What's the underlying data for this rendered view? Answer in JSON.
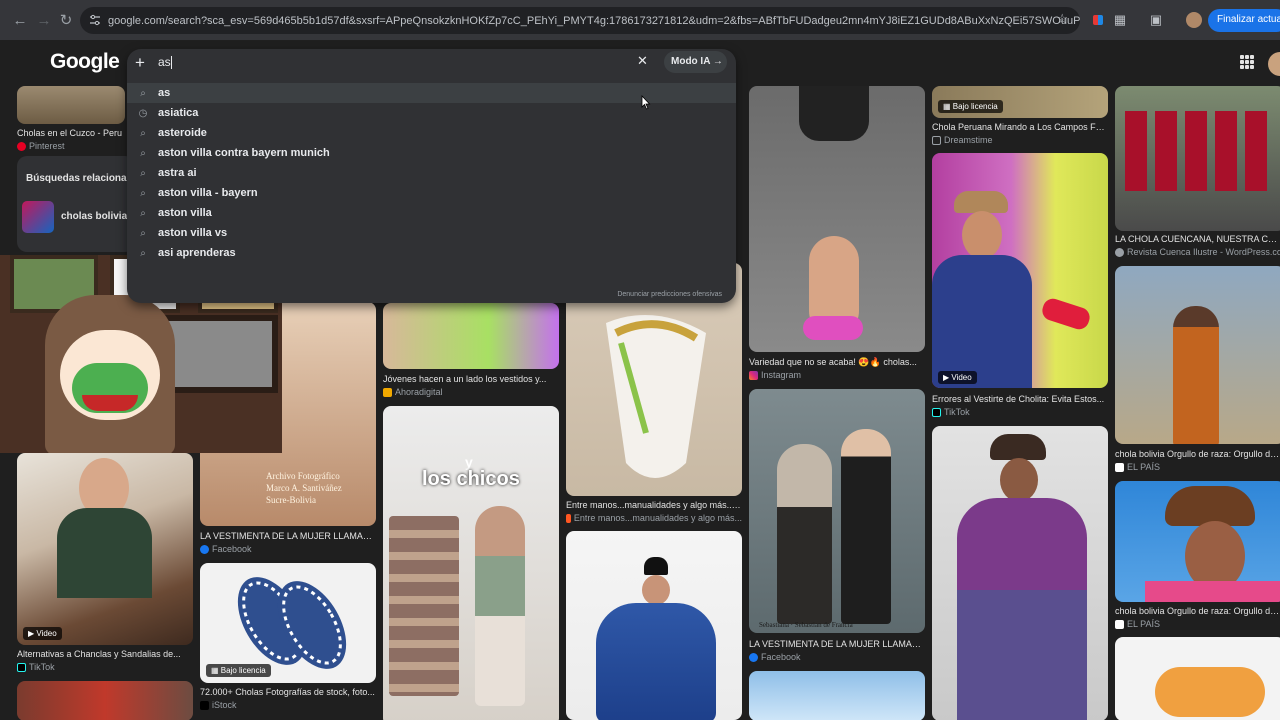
{
  "browser": {
    "url": "google.com/search?sca_esv=569d465b5b1d57df&sxsrf=APpeQnsokzknHOKfZp7cC_PEhYi_PMYT4g:1786173271812&udm=2&fbs=ABfTbFUDadgeu2mn4mYJ8iEZ1GUDd8ABuXxNzQEi57SWOuuPdfVFhgBbO079P_7XyIRU...",
    "update_label": "Finalizar actualiz"
  },
  "header": {
    "logo": "Google"
  },
  "search": {
    "query": "as",
    "ai_mode_label": "Modo IA",
    "suggestions": [
      {
        "text": "as",
        "icon": "search-icon"
      },
      {
        "text": "asiatica",
        "icon": "history-icon"
      },
      {
        "text": "asteroide",
        "icon": "search-icon"
      },
      {
        "text": "aston villa contra bayern munich",
        "icon": "search-icon"
      },
      {
        "text": "astra ai",
        "icon": "search-icon"
      },
      {
        "text": "aston villa - bayern",
        "icon": "search-icon"
      },
      {
        "text": "aston villa",
        "icon": "search-icon"
      },
      {
        "text": "aston villa vs",
        "icon": "search-icon"
      },
      {
        "text": "asi aprenderas",
        "icon": "search-icon"
      }
    ],
    "report_label": "Denunciar predicciones ofensivas"
  },
  "related": {
    "title": "Búsquedas relacionad",
    "item": "cholas bolivian"
  },
  "results": {
    "col1_top": {
      "caption": "Cholas en el Cuzco - Peru",
      "source": "Pinterest"
    },
    "col1_video": {
      "caption": "Alternativas a Chanclas y Sandalias de...",
      "source": "TikTok",
      "badge": "Video"
    },
    "col2_mid": {
      "caption": "LA VESTIMENTA DE LA MUJER LLAMADA...",
      "source": "Facebook",
      "watermark1": "Archivo Fotográfico",
      "watermark2": "Marco A. Santiváñez",
      "watermark3": "Sucre-Bolivia"
    },
    "col2_bottom": {
      "caption": "72.000+ Cholas Fotografías de stock, foto...",
      "source": "iStock",
      "badge": "Bajo licencia"
    },
    "col3_top": {
      "caption": "Jóvenes hacen a un lado los vestidos y...",
      "source": "Ahoradigital"
    },
    "col3_chicos": {
      "overlay_small": "y",
      "overlay": "los chicos"
    },
    "col4_mid": {
      "caption": "Entre manos...manualidades y algo más...:...",
      "source": "Entre manos...manualidades y algo más..."
    },
    "col5_top": {
      "caption": "Variedad que no se acaba! 😍🔥 cholas...",
      "source": "Instagram"
    },
    "col5_mid": {
      "caption": "LA VESTIMENTA DE LA MUJER LLAMADA...",
      "source": "Facebook",
      "photo_caption": "Sebastiana · Sebastian de Francia"
    },
    "col6_top": {
      "caption": "Chola Peruana Mirando a Los Campos Fot...",
      "source": "Dreamstime",
      "badge": "Bajo licencia"
    },
    "col6_mid": {
      "caption": "Errores al Vestirte de Cholita: Evita Estos...",
      "source": "TikTok",
      "badge": "Video"
    },
    "col7_top": {
      "caption": "LA CHOLA CUENCANA, NUESTRA CHOLA...",
      "source": "Revista Cuenca Ilustre - WordPress.com"
    },
    "col7_mid": {
      "caption": "chola bolivia Orgullo de raza: Orgullo de...",
      "source": "EL PAÍS"
    },
    "col7_bot": {
      "caption": "chola bolivia Orgullo de raza: Orgullo de...",
      "source": "EL PAÍS"
    }
  },
  "colors": {
    "background": "#1f1f1f",
    "panel": "#303134",
    "accent_blue": "#1a73e8"
  }
}
